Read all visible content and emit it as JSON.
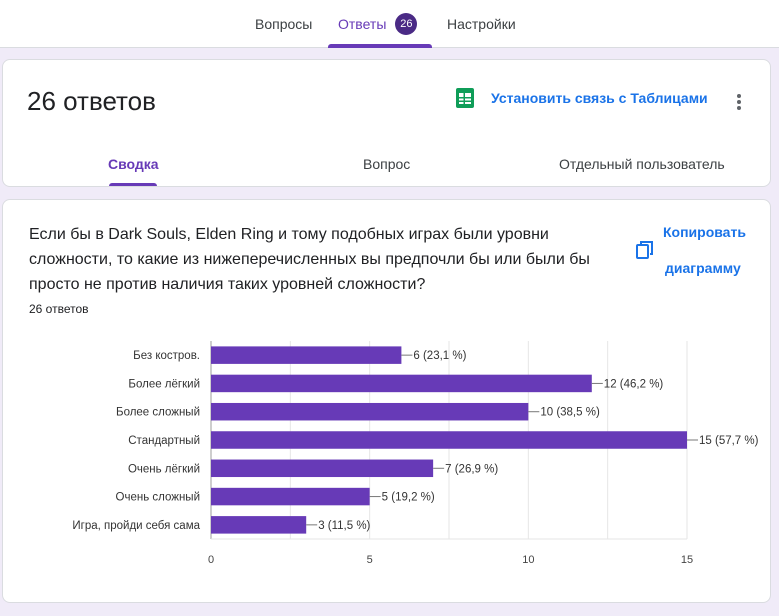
{
  "nav": {
    "tabs": [
      {
        "label": "Вопросы"
      },
      {
        "label": "Ответы",
        "badge": "26"
      },
      {
        "label": "Настройки"
      }
    ]
  },
  "summary": {
    "title": "26 ответов",
    "sheets_link": "Установить связь с Таблицами",
    "subtabs": [
      "Сводка",
      "Вопрос",
      "Отдельный пользователь"
    ]
  },
  "question": {
    "text": "Если бы в Dark Souls, Elden Ring и тому подобных играх были уровни сложности, то какие из нижеперечисленных вы предпочли бы или были бы просто не против наличия таких уровней сложности?",
    "responses": "26 ответов",
    "copy_line1": "Копировать",
    "copy_line2": "диаграмму"
  },
  "colors": {
    "accent": "#673ab7",
    "bar": "#673ab7",
    "link": "#1a73e8",
    "badge": "#4a2a85"
  },
  "chart_data": {
    "type": "bar",
    "orientation": "horizontal",
    "categories": [
      "Без костров.",
      "Более лёгкий",
      "Более сложный",
      "Стандартный",
      "Очень лёгкий",
      "Очень сложный",
      "Игра, пройди себя сама"
    ],
    "values": [
      6,
      12,
      10,
      15,
      7,
      5,
      3
    ],
    "labels": [
      "6 (23,1 %)",
      "12 (46,2 %)",
      "10 (38,5 %)",
      "15 (57,7 %)",
      "7 (26,9 %)",
      "5 (19,2 %)",
      "3 (11,5 %)"
    ],
    "xlim": [
      0,
      15
    ],
    "xticks": [
      "0",
      "5",
      "10",
      "15"
    ],
    "grid": true
  }
}
